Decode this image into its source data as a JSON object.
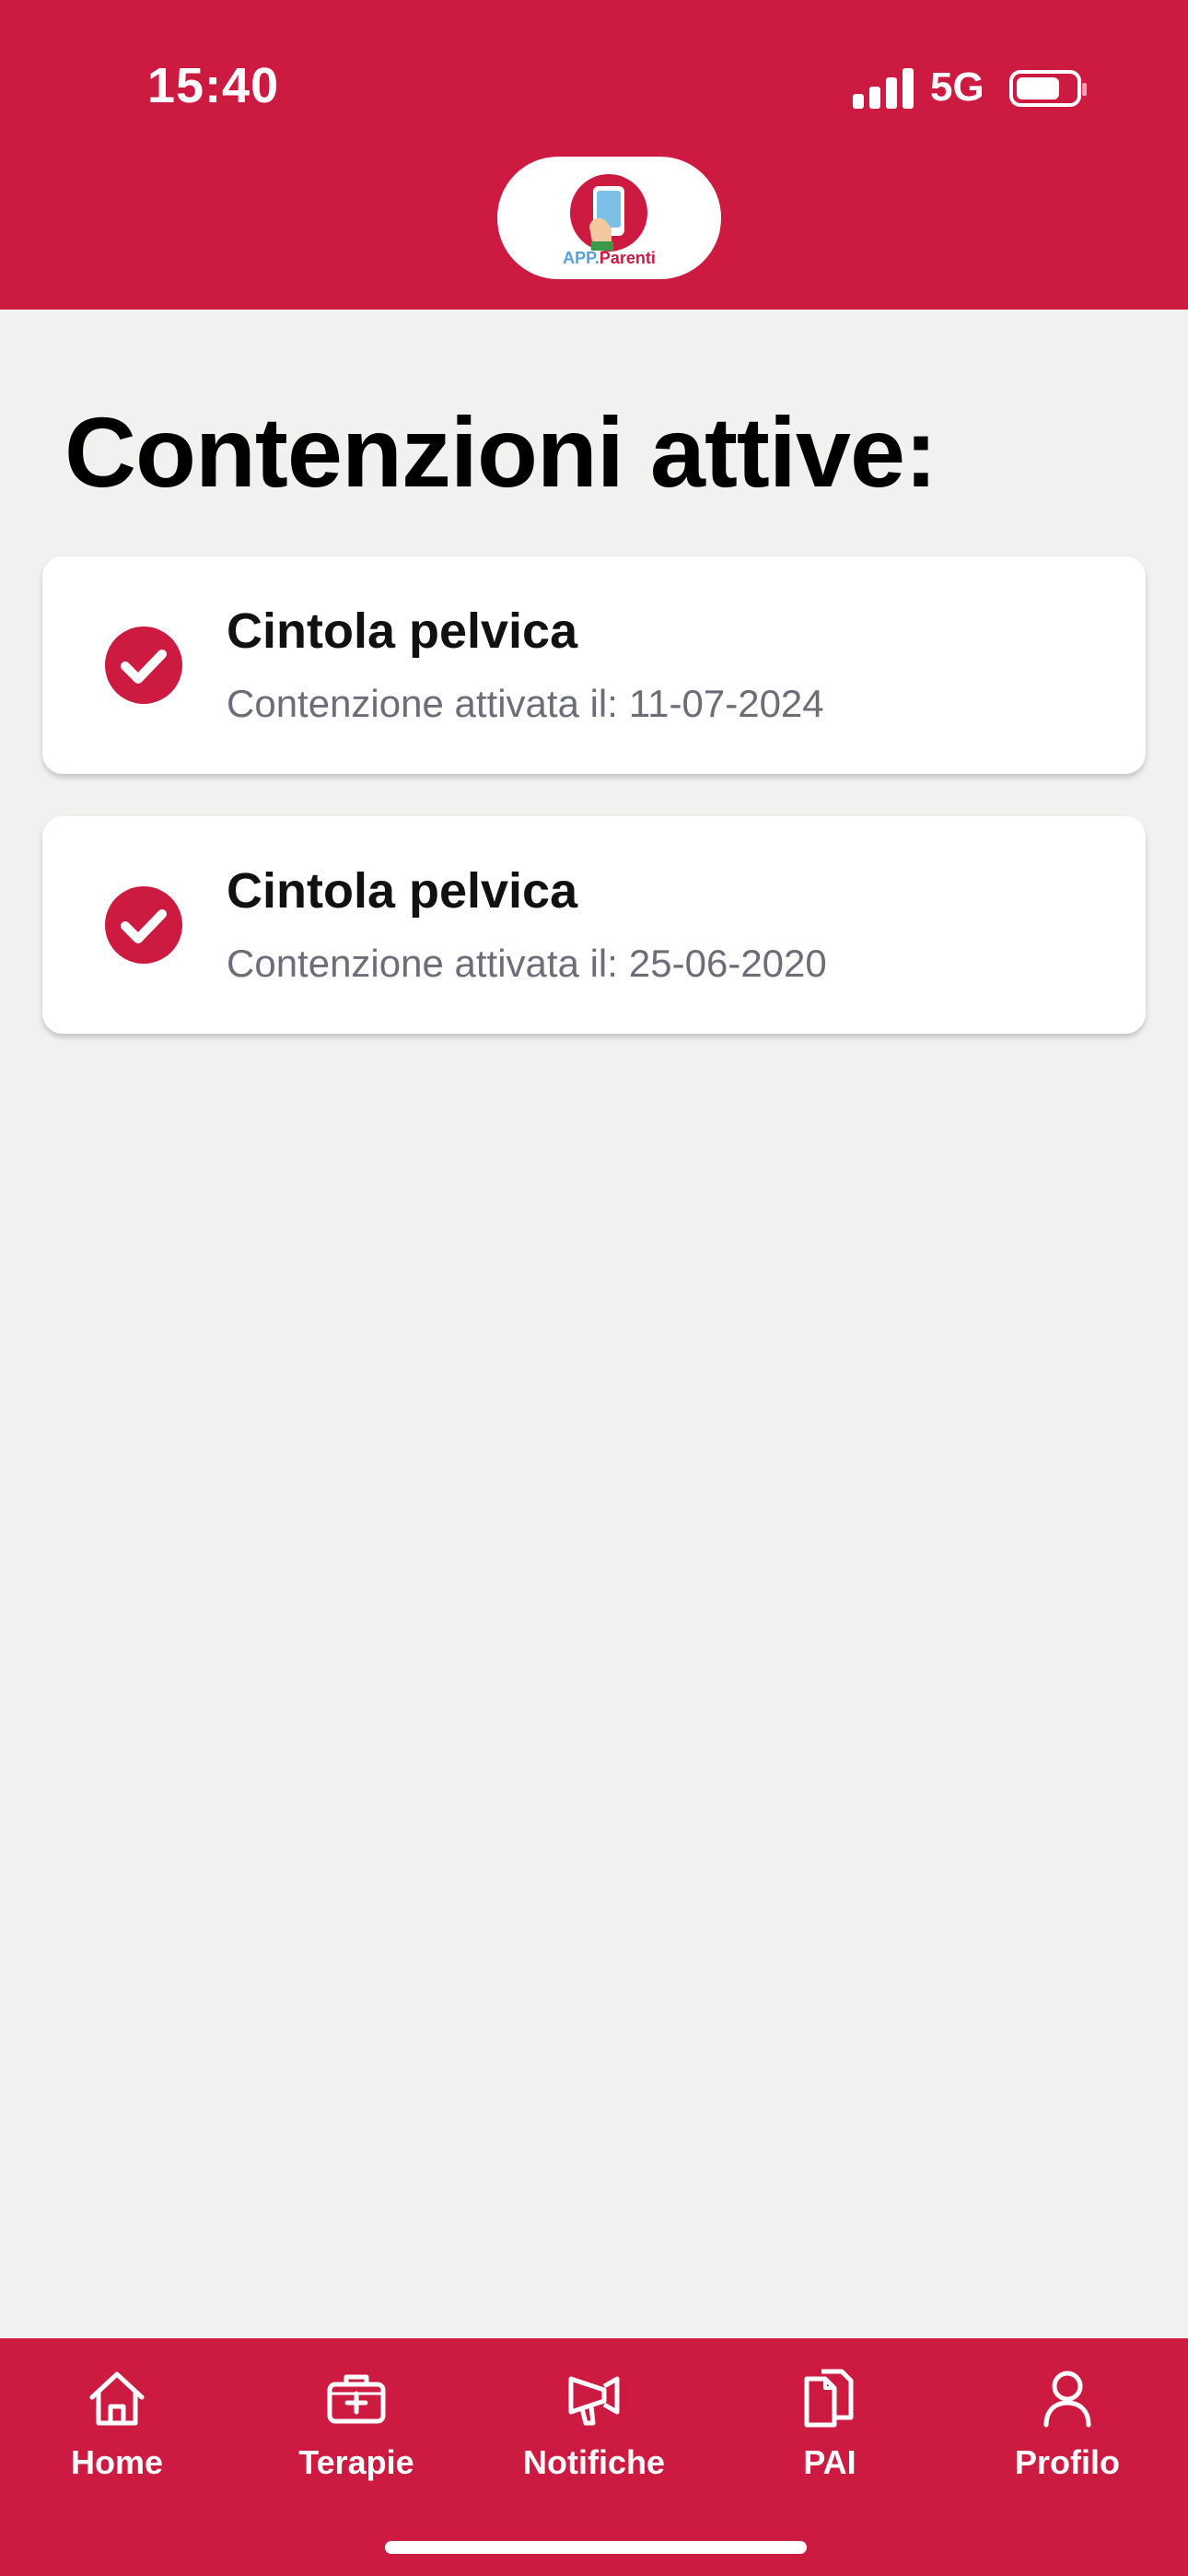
{
  "status_bar": {
    "time": "15:40",
    "network": "5G"
  },
  "header": {
    "logo_app": "APP.",
    "logo_name": "Parenti",
    "background_color": "#cc1a41"
  },
  "page": {
    "title": "Contenzioni attive:"
  },
  "restraints": [
    {
      "name": "Cintola pelvica",
      "label": "Contenzione attivata il:",
      "date": "11-07-2024",
      "icon": "check-circle-icon"
    },
    {
      "name": "Cintola pelvica",
      "label": "Contenzione attivata il:",
      "date": "25-06-2020",
      "icon": "check-circle-icon"
    }
  ],
  "tabbar": {
    "items": [
      {
        "label": "Home",
        "icon": "home-icon"
      },
      {
        "label": "Terapie",
        "icon": "medical-kit-icon"
      },
      {
        "label": "Notifiche",
        "icon": "megaphone-icon"
      },
      {
        "label": "PAI",
        "icon": "documents-icon"
      },
      {
        "label": "Profilo",
        "icon": "person-icon"
      }
    ]
  },
  "colors": {
    "accent": "#cc1a41",
    "background": "#f1f1f0",
    "card": "#ffffff",
    "secondary_text": "#6b6e78"
  }
}
